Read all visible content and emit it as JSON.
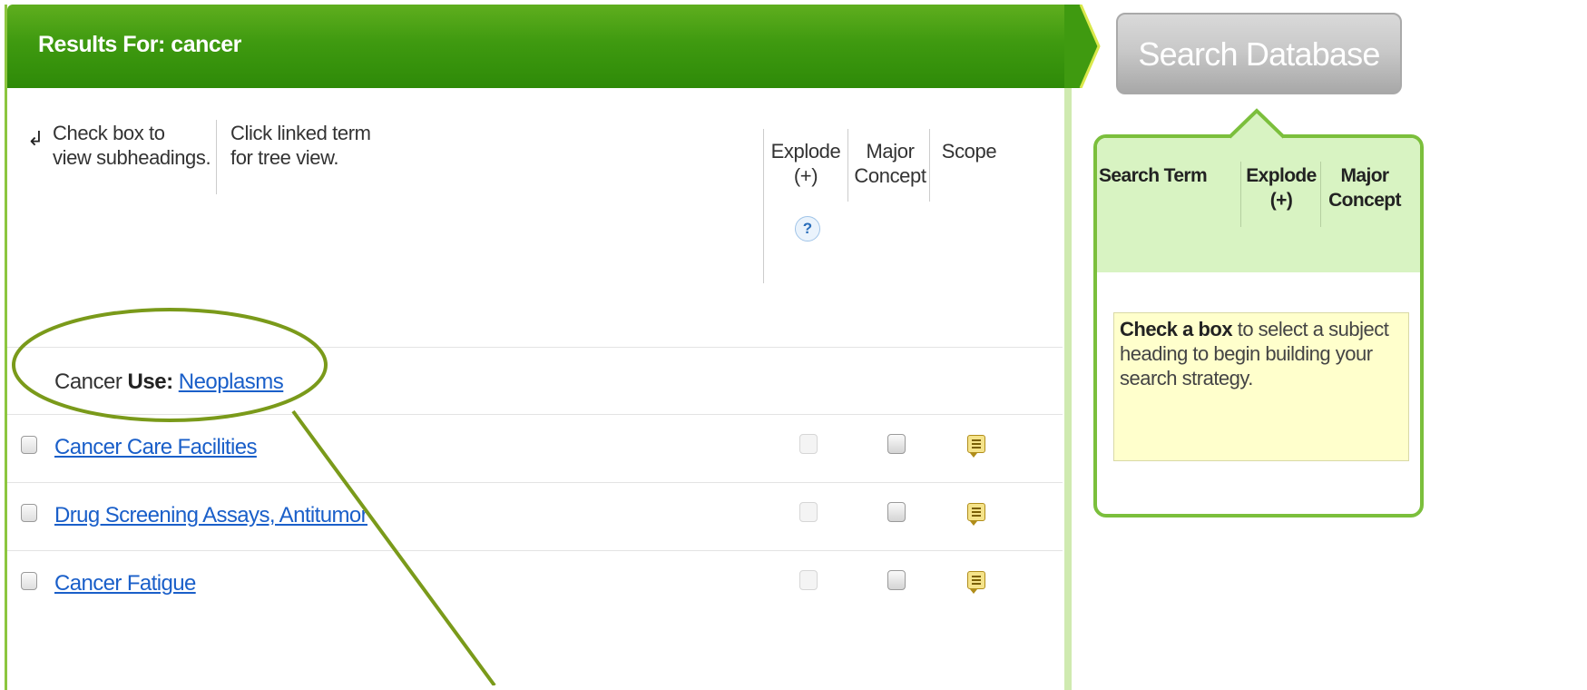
{
  "results": {
    "title": "Results For: cancer",
    "instructions": {
      "checkbox_hint_line1": "Check box to",
      "checkbox_hint_line2": "view subheadings.",
      "link_hint_line1": "Click linked term",
      "link_hint_line2": "for tree view."
    },
    "columns": {
      "explode_line1": "Explode",
      "explode_line2": "(+)",
      "explode_help": "?",
      "major_line1": "Major",
      "major_line2": "Concept",
      "scope": "Scope"
    },
    "use_row": {
      "term": "Cancer",
      "use_label": "Use:",
      "use_link": "Neoplasms"
    },
    "rows": [
      {
        "term": "Cancer Care Facilities"
      },
      {
        "term": "Drug Screening Assays, Antitumor"
      },
      {
        "term": "Cancer Fatigue"
      }
    ]
  },
  "search_button": {
    "label": "Search Database"
  },
  "builder": {
    "col_search_term": "Search Term",
    "col_explode_line1": "Explode",
    "col_explode_line2": "(+)",
    "col_major_line1": "Major",
    "col_major_line2": "Concept",
    "hint_bold": "Check a box",
    "hint_rest": " to select a subject heading to begin building your search strategy."
  },
  "colors": {
    "header_green": "#3f9a10",
    "panel_border": "#7bbf3c",
    "link_blue": "#1a5fc9",
    "annotation": "#7a9a1a"
  }
}
